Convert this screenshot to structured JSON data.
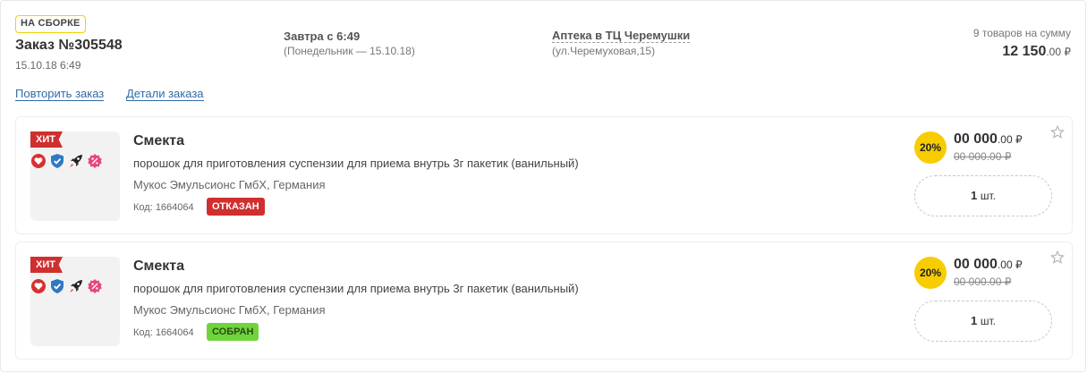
{
  "order": {
    "status_badge": "НА СБОРКЕ",
    "number": "Заказ №305548",
    "date": "15.10.18 6:49",
    "delivery_time": "Завтра с 6:49",
    "delivery_day": "(Понедельник — 15.10.18)",
    "pharmacy_name": "Аптека в ТЦ Черемушки",
    "pharmacy_address": "(ул.Черемуховая,15)",
    "summary_count": "9 товаров на сумму",
    "summary_total_main": "12 150",
    "summary_total_cents": ".00 ₽",
    "repeat_link": "Повторить заказ",
    "details_link": "Детали заказа"
  },
  "colors": {
    "accent_yellow": "#f7cd00",
    "hit_red": "#cf2f2f",
    "refused_red": "#cf2f2f",
    "ready_green": "#6fd43c",
    "link_blue": "#2f6ca8"
  },
  "products": [
    {
      "hit_label": "ХИТ",
      "icons": [
        "heart-icon",
        "shield-check-icon",
        "rocket-icon",
        "percent-badge-icon"
      ],
      "title": "Смекта",
      "description": "порошок для приготовления суспензии для приема внутрь 3г пакетик (ванильный)",
      "maker": "Мукос Эмульсионс ГмбХ, Германия",
      "code": "Код: 1664064",
      "state": "ОТКАЗАН",
      "discount": "20%",
      "price_main": "00 000",
      "price_cents": ".00 ₽",
      "price_old": "00 000.00 ₽",
      "quantity": "1",
      "quantity_unit": "шт."
    },
    {
      "hit_label": "ХИТ",
      "icons": [
        "heart-icon",
        "shield-check-icon",
        "rocket-icon",
        "percent-badge-icon"
      ],
      "title": "Смекта",
      "description": "порошок для приготовления суспензии для приема внутрь 3г пакетик (ванильный)",
      "maker": "Мукос Эмульсионс ГмбХ, Германия",
      "code": "Код: 1664064",
      "state": "СОБРАН",
      "discount": "20%",
      "price_main": "00 000",
      "price_cents": ".00 ₽",
      "price_old": "00 000.00 ₽",
      "quantity": "1",
      "quantity_unit": "шт."
    }
  ]
}
